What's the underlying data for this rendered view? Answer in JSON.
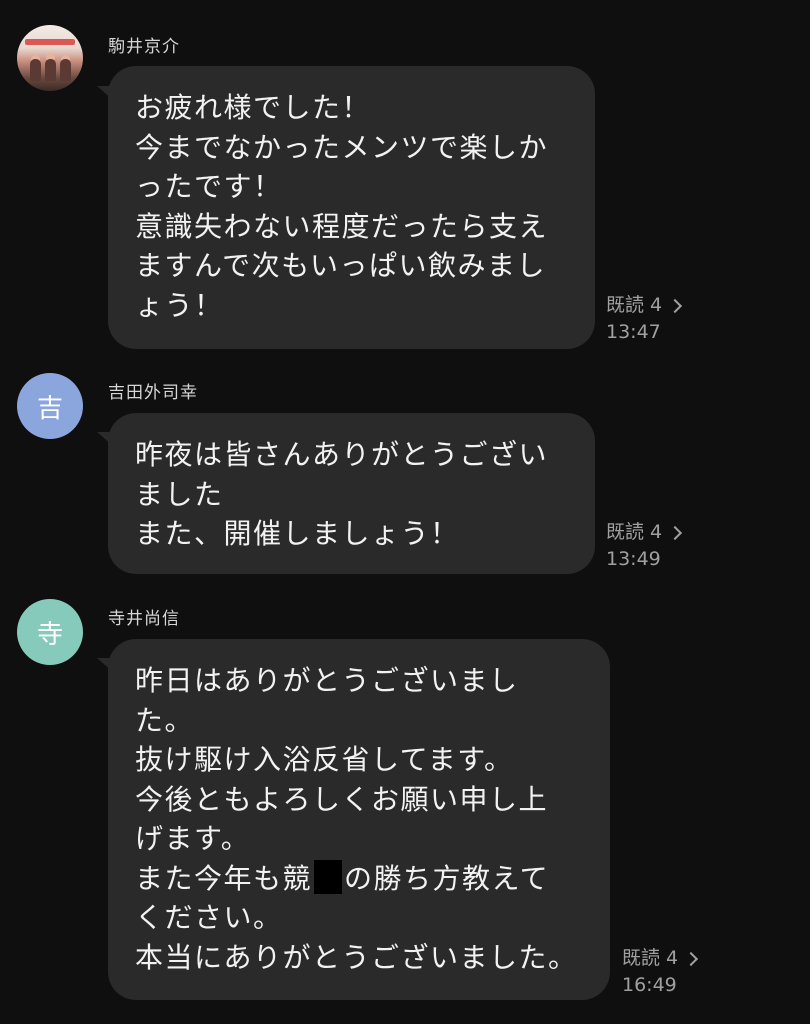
{
  "messages": [
    {
      "sender": "駒井京介",
      "avatar_type": "photo",
      "avatar_text": "",
      "avatar_color": "",
      "text": "お疲れ様でした！\n今までなかったメンツで楽しか\nったです！\n意識失わない程度だったら支え\nますんで次もいっぱい飲みまし\nょう！",
      "read_label": "既読 4",
      "time": "13:47"
    },
    {
      "sender": "吉田外司幸",
      "avatar_type": "initial",
      "avatar_text": "吉",
      "avatar_color": "#8aa6dc",
      "text": "昨夜は皆さんありがとうござい\nました\nまた、開催しましょう！",
      "read_label": "既読 4",
      "time": "13:49"
    },
    {
      "sender": "寺井尚信",
      "avatar_type": "initial",
      "avatar_text": "寺",
      "avatar_color": "#86cabb",
      "text_before_redaction": "昨日はありがとうございまし\nた。\n抜け駆け入浴反省してます。\n今後ともよろしくお願い申し上\nげます。\nまた今年も競",
      "text_after_redaction": "の勝ち方教えて\nください。\n本当にありがとうございました。",
      "read_label": "既読 4",
      "time": "16:49"
    }
  ],
  "colors": {
    "background": "#0f0f0f",
    "bubble": "#2a2a2a",
    "text": "#f2f2f2",
    "meta": "#a0a0a0"
  },
  "icons": {
    "read_chevron": "chevron-right-icon"
  }
}
